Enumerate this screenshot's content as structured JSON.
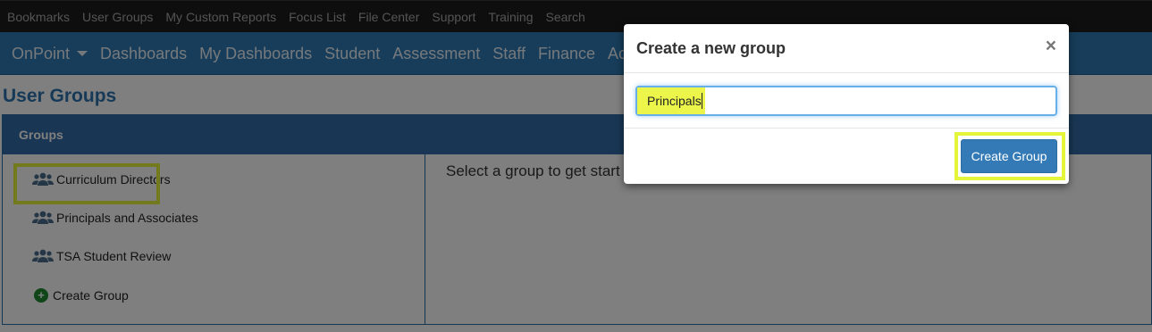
{
  "topbar": {
    "links": [
      "Bookmarks",
      "User Groups",
      "My Custom Reports",
      "Focus List",
      "File Center",
      "Support",
      "Training",
      "Search"
    ]
  },
  "mainnav": {
    "brand": "OnPoint",
    "items": [
      "Dashboards",
      "My Dashboards",
      "Student",
      "Assessment",
      "Staff",
      "Finance",
      "Acc"
    ]
  },
  "page": {
    "title": "User Groups",
    "panel_header": "Groups",
    "groups": [
      "Curriculum Directors",
      "Principals and Associates",
      "TSA Student Review"
    ],
    "create_link": "Create Group",
    "placeholder_text": "Select a group to get start"
  },
  "modal": {
    "title": "Create a new group",
    "close": "×",
    "input_value": "Principals",
    "button_label": "Create Group"
  },
  "colors": {
    "topbar": "#1c1c1c",
    "nav": "#2f7ab4",
    "panel_header": "#336fa8",
    "primary_button": "#337ab7",
    "highlight": "#e5f53a"
  }
}
